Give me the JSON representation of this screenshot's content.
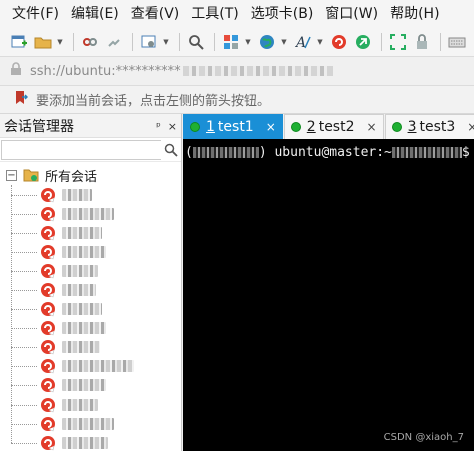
{
  "menu": {
    "items": [
      "文件(F)",
      "编辑(E)",
      "查看(V)",
      "工具(T)",
      "选项卡(B)",
      "窗口(W)",
      "帮助(H)"
    ]
  },
  "toolbar": {
    "buttons": [
      {
        "icon": "new-session-icon",
        "dropdown": false
      },
      {
        "icon": "open-folder-icon",
        "dropdown": true
      },
      {
        "icon": "disconnect-icon",
        "dropdown": false
      },
      {
        "icon": "reconnect-icon",
        "dropdown": false
      },
      {
        "icon": "properties-icon",
        "dropdown": true
      },
      {
        "icon": "find-icon",
        "dropdown": false
      },
      {
        "icon": "layout-icon",
        "dropdown": true
      },
      {
        "icon": "globe-icon",
        "dropdown": true
      },
      {
        "icon": "font-icon",
        "dropdown": true
      },
      {
        "icon": "xshell-icon",
        "dropdown": false
      },
      {
        "icon": "xftp-icon",
        "dropdown": false
      },
      {
        "icon": "fullscreen-icon",
        "dropdown": false
      },
      {
        "icon": "lock-icon",
        "dropdown": false
      },
      {
        "icon": "keyboard-icon",
        "dropdown": false
      }
    ]
  },
  "address": {
    "value": "ssh://ubuntu:**********"
  },
  "hint": {
    "text": "要添加当前会话，点击左侧的箭头按钮。"
  },
  "session_panel": {
    "title": "会话管理器",
    "pin_label": "ᵖ",
    "close_label": "×",
    "root_label": "所有会话",
    "toggle_symbol": "−",
    "session_count": 14
  },
  "tabs": [
    {
      "num": "1",
      "label": "test1",
      "active": true,
      "close": "×"
    },
    {
      "num": "2",
      "label": "test2",
      "active": false,
      "close": "×"
    },
    {
      "num": "3",
      "label": "test3",
      "active": false,
      "close": "×"
    }
  ],
  "tab_more": "◂",
  "terminal": {
    "open_paren": "(",
    "prompt": ") ubuntu@master:~",
    "prompt_end": "$"
  },
  "watermark": "CSDN @xiaoh_7",
  "colors": {
    "accent": "#1a8fd6",
    "status_green": "#1fb033",
    "session_red": "#e23b2a",
    "terminal_bg": "#000000"
  }
}
